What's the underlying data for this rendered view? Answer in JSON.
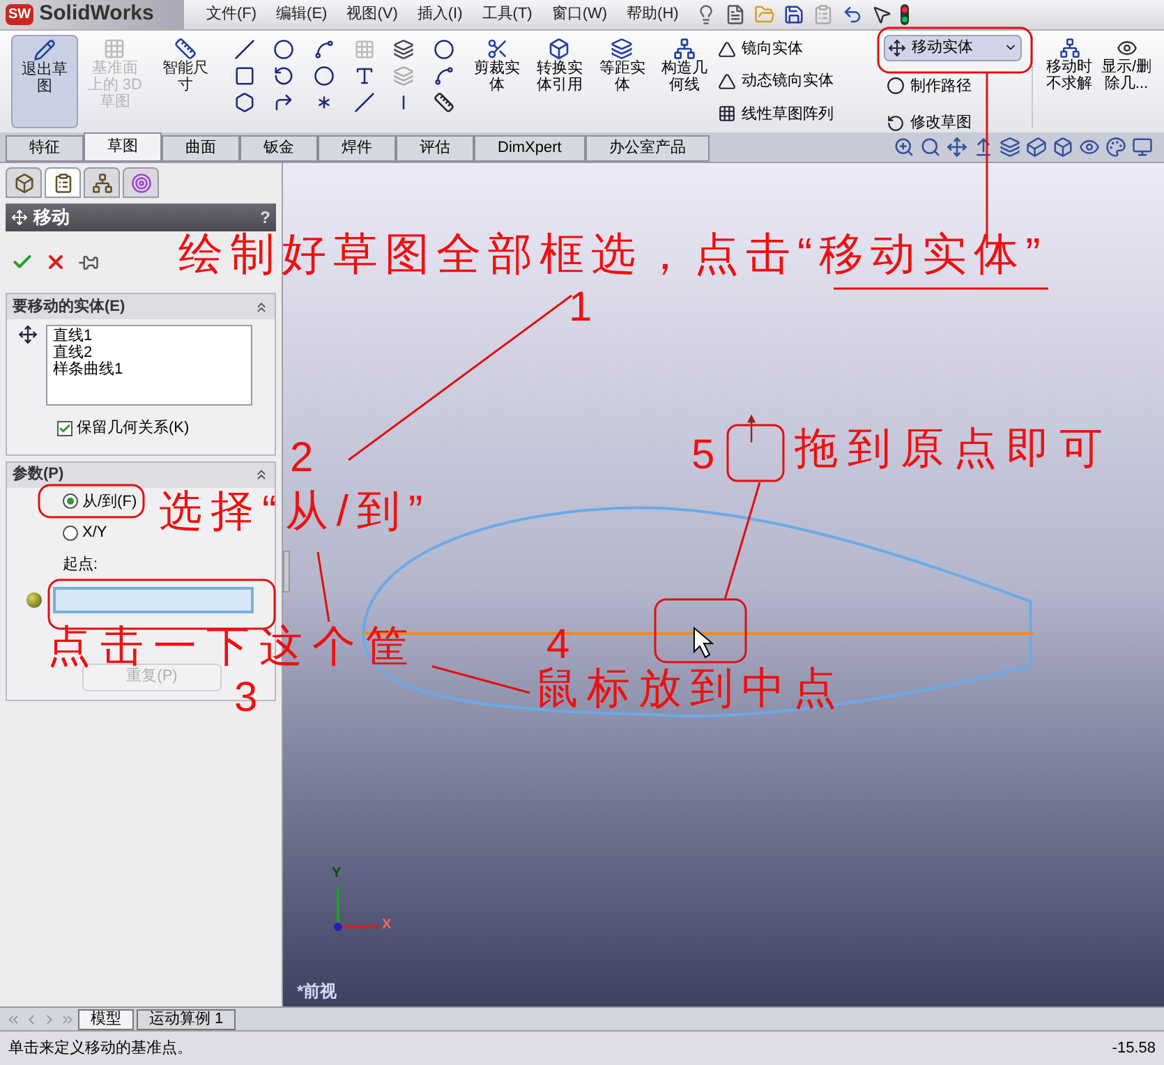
{
  "app": {
    "logo": "SW",
    "name": "SolidWorks"
  },
  "menu": [
    "文件(F)",
    "编辑(E)",
    "视图(V)",
    "插入(I)",
    "工具(T)",
    "窗口(W)",
    "帮助(H)"
  ],
  "ribbon": {
    "large_buttons": [
      {
        "label": "退出草图",
        "selected": true,
        "disabled": false
      },
      {
        "label": "基准面上的 3D 草图",
        "selected": false,
        "disabled": true
      },
      {
        "label": "智能尺寸",
        "selected": false,
        "disabled": false
      }
    ],
    "tool_buttons": [
      "剪裁实体",
      "转换实体引用",
      "等距实体",
      "构造几何线"
    ],
    "list_tools": [
      "镜向实体",
      "动态镜向实体",
      "线性草图阵列"
    ],
    "move_tools": [
      {
        "label": "移动实体",
        "selected": true
      },
      {
        "label": "制作路径",
        "selected": false
      },
      {
        "label": "修改草图",
        "selected": false
      }
    ],
    "right_buttons": [
      "移动时不求解",
      "显示/删除几..."
    ]
  },
  "tabs": [
    {
      "label": "特征",
      "selected": false
    },
    {
      "label": "草图",
      "selected": true
    },
    {
      "label": "曲面",
      "selected": false
    },
    {
      "label": "钣金",
      "selected": false
    },
    {
      "label": "焊件",
      "selected": false
    },
    {
      "label": "评估",
      "selected": false
    },
    {
      "label": "DimXpert",
      "selected": false
    },
    {
      "label": "办公室产品",
      "selected": false
    }
  ],
  "property_manager": {
    "title": "移动",
    "help": "?",
    "entities_group": {
      "title": "要移动的实体(E)",
      "items": [
        "直线1",
        "直线2",
        "样条曲线1"
      ],
      "keep_relations": {
        "label": "保留几何关系(K)",
        "checked": true
      }
    },
    "params_group": {
      "title": "参数(P)",
      "options": [
        {
          "label": "从/到(F)",
          "selected": true
        },
        {
          "label": "X/Y",
          "selected": false
        }
      ],
      "start_label": "起点:",
      "repeat_button": {
        "label": "重复(P)",
        "disabled": true
      }
    }
  },
  "viewport": {
    "view_label": "*前视",
    "axis_labels": [
      "Y",
      "X"
    ]
  },
  "annotations": [
    "绘制好草图全部框选，点击“移动实体”",
    "1",
    "2",
    "5",
    "拖到原点即可",
    "选择“从/到”",
    "点击一下这个筐",
    "4",
    "3",
    "鼠标放到中点"
  ],
  "bottom_tabs": [
    {
      "label": "模型",
      "selected": true
    },
    {
      "label": "运动算例 1",
      "selected": false
    }
  ],
  "status_bar": {
    "message": "单击来定义移动的基准点。",
    "value": "-15.58"
  }
}
